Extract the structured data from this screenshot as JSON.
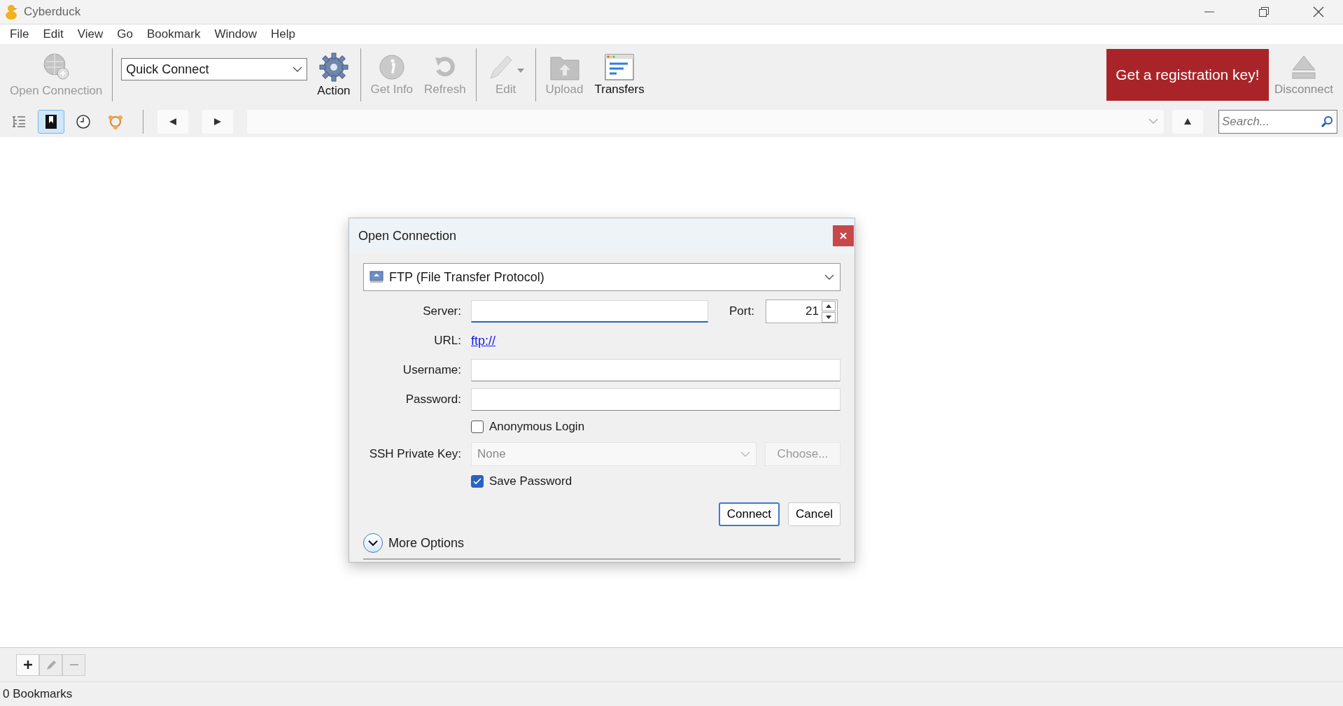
{
  "window": {
    "title": "Cyberduck"
  },
  "menu": [
    "File",
    "Edit",
    "View",
    "Go",
    "Bookmark",
    "Window",
    "Help"
  ],
  "toolbar": {
    "items": [
      {
        "kind": "connect",
        "label": "Open Connection",
        "disabled": true
      },
      {
        "kind": "separator"
      },
      {
        "kind": "combo",
        "value": "Quick Connect"
      },
      {
        "kind": "action",
        "label": "Action",
        "disabled": false
      },
      {
        "kind": "separator"
      },
      {
        "kind": "info",
        "label": "Get Info",
        "disabled": true
      },
      {
        "kind": "refresh",
        "label": "Refresh",
        "disabled": true
      },
      {
        "kind": "separator"
      },
      {
        "kind": "edit",
        "label": "Edit",
        "disabled": true
      },
      {
        "kind": "separator"
      },
      {
        "kind": "upload",
        "label": "Upload",
        "disabled": true
      },
      {
        "kind": "transfers",
        "label": "Transfers",
        "disabled": false
      }
    ],
    "registration_button": "Get a registration key!",
    "disconnect": {
      "label": "Disconnect",
      "disabled": true
    }
  },
  "navigation": {
    "views": [
      {
        "kind": "browser",
        "selected": false
      },
      {
        "kind": "bookmarks",
        "selected": true
      },
      {
        "kind": "history",
        "selected": false
      },
      {
        "kind": "bonjour",
        "selected": false
      }
    ],
    "search": {
      "placeholder": "Search..."
    }
  },
  "dialog": {
    "title": "Open Connection",
    "protocol": "FTP (File Transfer Protocol)",
    "server": {
      "label": "Server:",
      "focused": true
    },
    "port": {
      "label": "Port:",
      "value": "21"
    },
    "url": {
      "label": "URL:",
      "value": "ftp://"
    },
    "username": {
      "label": "Username:"
    },
    "password": {
      "label": "Password:"
    },
    "anonymous_login": {
      "label": "Anonymous Login",
      "checked": false
    },
    "ssh_private_key": {
      "label": "SSH Private Key:",
      "value": "None",
      "disabled": true,
      "choose": "Choose..."
    },
    "save_password": {
      "label": "Save Password",
      "checked": true
    },
    "buttons": [
      {
        "label": "Connect",
        "default": true
      },
      {
        "label": "Cancel",
        "default": false
      }
    ],
    "more_options": {
      "label": "More Options",
      "expanded": false
    }
  },
  "bookmark_buttons": [
    {
      "kind": "add",
      "disabled": false
    },
    {
      "kind": "edit",
      "disabled": true
    },
    {
      "kind": "remove",
      "disabled": true
    }
  ],
  "status_bar": "0 Bookmarks"
}
